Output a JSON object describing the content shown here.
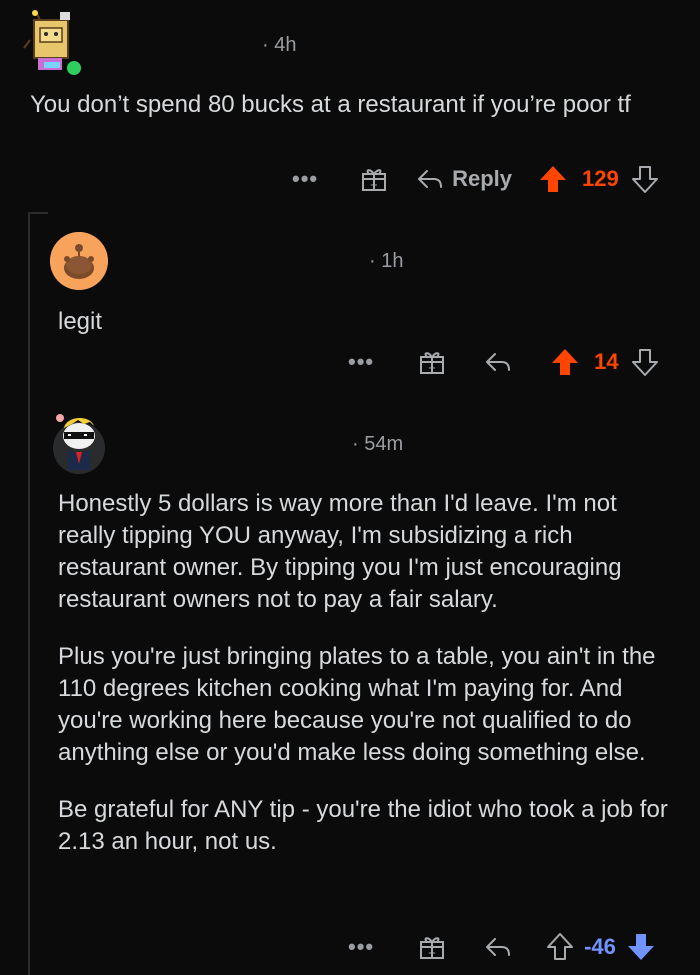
{
  "comments": [
    {
      "time": "· 4h",
      "paragraphs": [
        "You don’t spend 80 bucks at a restaurant if you’re poor tf"
      ],
      "more": "•••",
      "reply_label": "Reply",
      "score": "129",
      "vote_state": "upvoted"
    },
    {
      "time": "· 1h",
      "paragraphs": [
        "legit"
      ],
      "more": "•••",
      "score": "14",
      "vote_state": "upvoted"
    },
    {
      "time": "· 54m",
      "paragraphs": [
        "Honestly 5 dollars is way more than I'd leave. I'm not really tipping YOU anyway, I'm subsidizing a rich restaurant owner. By tipping you I'm just encouraging restaurant owners not to pay a fair salary.",
        "Plus you're just bringing plates to a table, you ain't in the 110 degrees kitchen cooking what I'm paying for. And you're working here because you're not qualified to do anything else or you'd make less doing something else.",
        "Be grateful for ANY tip - you're the idiot who took a job for 2.13 an hour, not us."
      ],
      "more": "•••",
      "score": "-46",
      "vote_state": "downvoted"
    }
  ],
  "colors": {
    "upvote": "#ff4500",
    "downvote": "#7193ff",
    "background": "#0b0b0c",
    "text": "#d7dadc",
    "online": "#2fcf5d"
  },
  "icons": [
    "more-options-icon",
    "gift-award-icon",
    "reply-arrow-icon",
    "upvote-arrow-icon",
    "downvote-arrow-icon",
    "online-status-icon"
  ]
}
